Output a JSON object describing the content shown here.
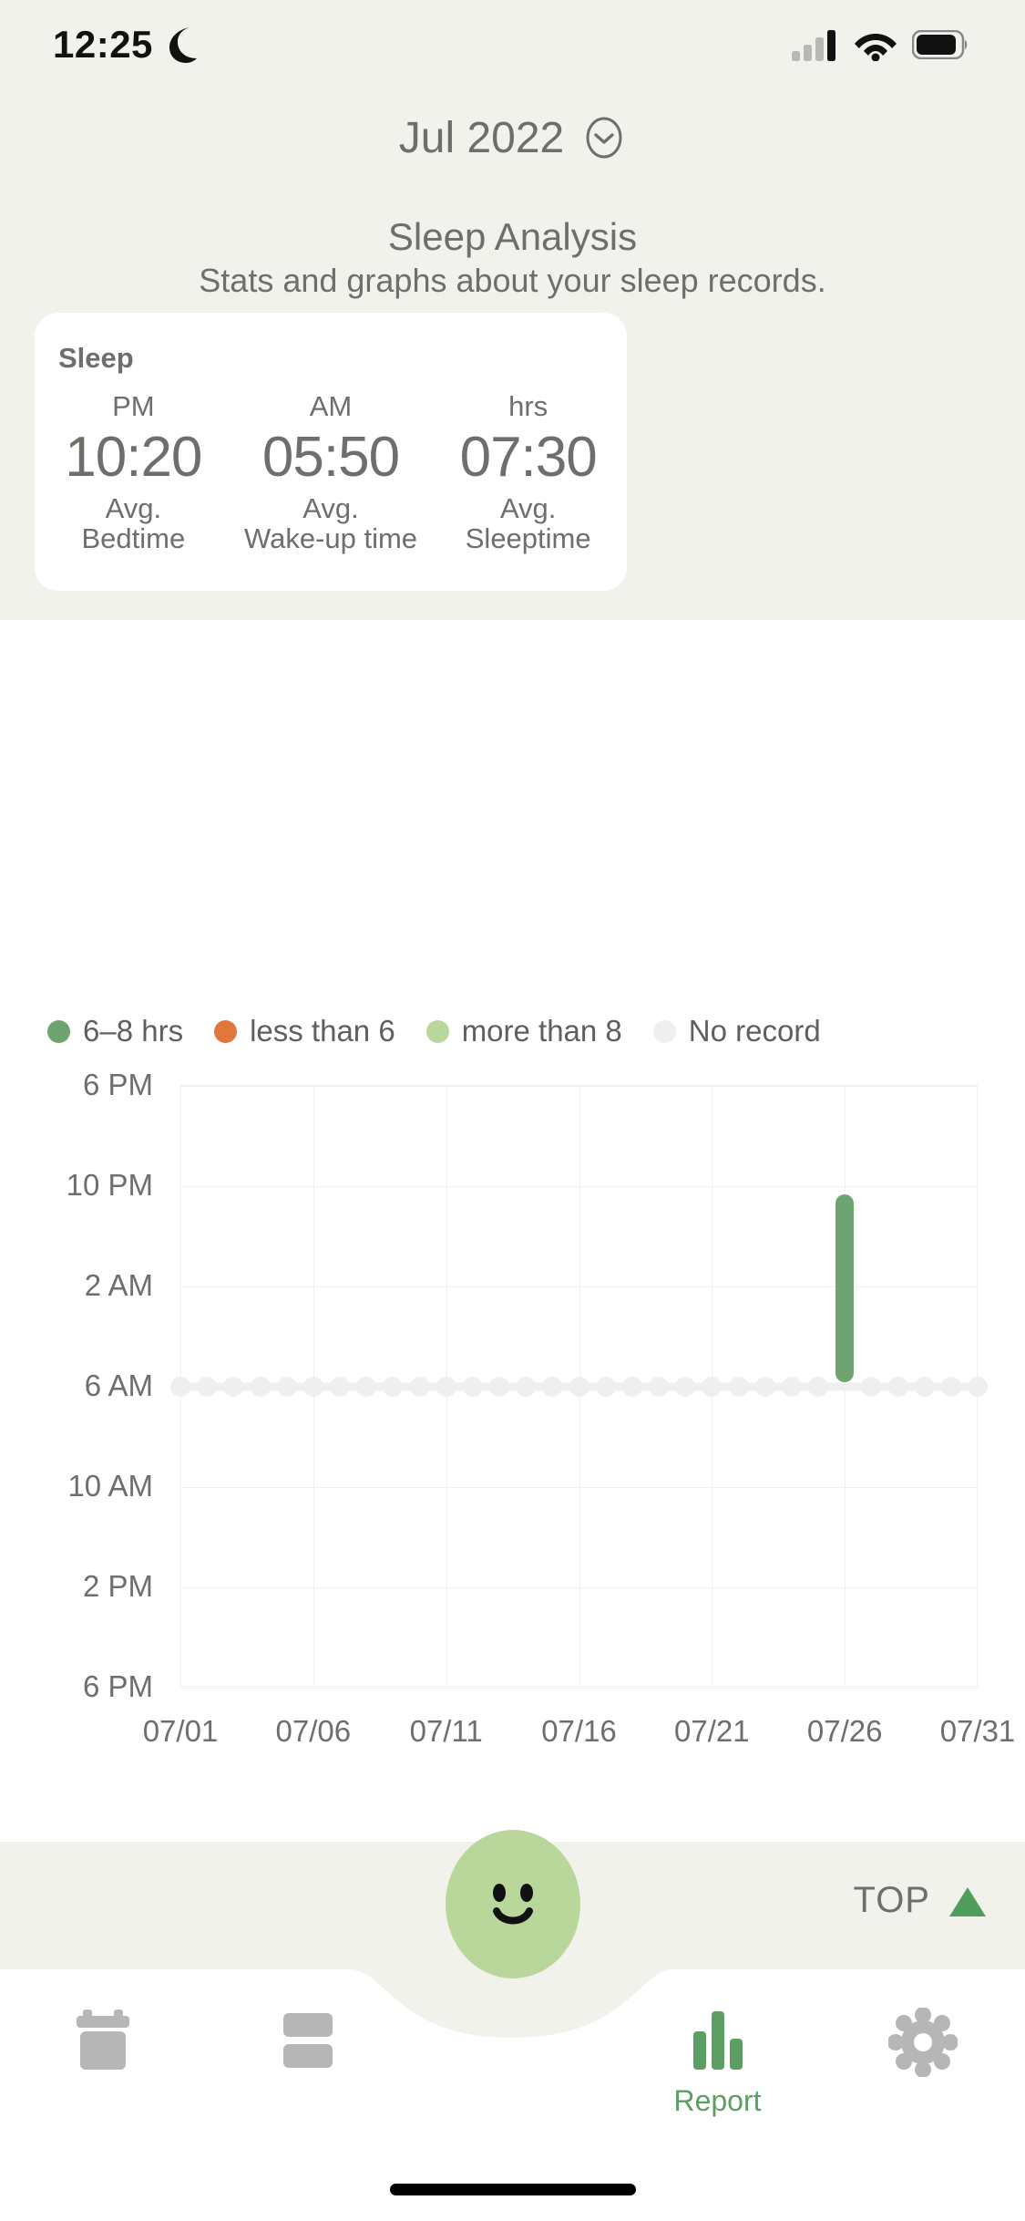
{
  "status_bar": {
    "time": "12:25",
    "dnd_icon": "crescent-moon-icon",
    "signal_icon": "cellular-signal-icon",
    "wifi_icon": "wifi-icon",
    "battery_icon": "battery-icon"
  },
  "header": {
    "month_label": "Jul 2022",
    "dropdown_icon": "chevron-down-circle-icon"
  },
  "page": {
    "title": "Sleep Analysis",
    "subtitle": "Stats and graphs about your sleep records."
  },
  "sleep_card": {
    "title": "Sleep",
    "stats": [
      {
        "unit": "PM",
        "value": "10:20",
        "label_line1": "Avg.",
        "label_line2": "Bedtime"
      },
      {
        "unit": "AM",
        "value": "05:50",
        "label_line1": "Avg.",
        "label_line2": "Wake-up time"
      },
      {
        "unit": "hrs",
        "value": "07:30",
        "label_line1": "Avg.",
        "label_line2": "Sleeptime"
      }
    ]
  },
  "legend": [
    {
      "label": "6–8 hrs",
      "color": "#6ea46f"
    },
    {
      "label": "less than 6",
      "color": "#e2773c"
    },
    {
      "label": "more than 8",
      "color": "#b9d79a"
    },
    {
      "label": "No record",
      "color": "#efefef"
    }
  ],
  "chart_data": {
    "type": "bar",
    "title": "",
    "xlabel": "",
    "ylabel": "",
    "orientation": "vertical-time-range",
    "grid": true,
    "legend_position": "top-left",
    "y_ticks": [
      "6 PM",
      "10 PM",
      "2 AM",
      "6 AM",
      "10 AM",
      "2 PM",
      "6 PM"
    ],
    "y_tick_hours": [
      18,
      22,
      26,
      30,
      34,
      38,
      42
    ],
    "ylim_hours": [
      18,
      42
    ],
    "x_ticks": [
      "07/01",
      "07/06",
      "07/11",
      "07/16",
      "07/21",
      "07/26",
      "07/31"
    ],
    "x_tick_days": [
      1,
      6,
      11,
      16,
      21,
      26,
      31
    ],
    "xlim_days": [
      1,
      31
    ],
    "no_record_line_hour": 30,
    "bars": [
      {
        "date": "07/26",
        "day": 26,
        "start": "22:20",
        "end": "05:50",
        "start_hour": 22.33,
        "end_hour": 29.83,
        "duration_hrs": 7.5,
        "category": "6–8 hrs",
        "color": "#6ea46f"
      }
    ],
    "no_record_days": [
      1,
      2,
      3,
      4,
      5,
      6,
      7,
      8,
      9,
      10,
      11,
      12,
      13,
      14,
      15,
      16,
      17,
      18,
      19,
      20,
      21,
      22,
      23,
      24,
      25,
      27,
      28,
      29,
      30,
      31
    ]
  },
  "bottom_nav": {
    "top_button_label": "TOP",
    "top_button_icon": "triangle-up-icon",
    "fab_icon": "smiley-face-icon",
    "items": [
      {
        "name": "calendar",
        "icon": "calendar-icon",
        "label": ""
      },
      {
        "name": "records",
        "icon": "list-cards-icon",
        "label": ""
      },
      {
        "name": "spacer",
        "icon": "",
        "label": ""
      },
      {
        "name": "report",
        "icon": "bar-chart-icon",
        "label": "Report"
      },
      {
        "name": "settings",
        "icon": "gear-icon",
        "label": ""
      }
    ]
  },
  "colors": {
    "background": "#f2f2ec",
    "card": "#ffffff",
    "text": "#6e6e6b",
    "accent_green": "#6ea46f",
    "light_green": "#b9d79a",
    "orange": "#e2773c",
    "grid": "#f0f0ee",
    "no_record": "#efefef",
    "nav_inactive": "#b6b6b6"
  }
}
